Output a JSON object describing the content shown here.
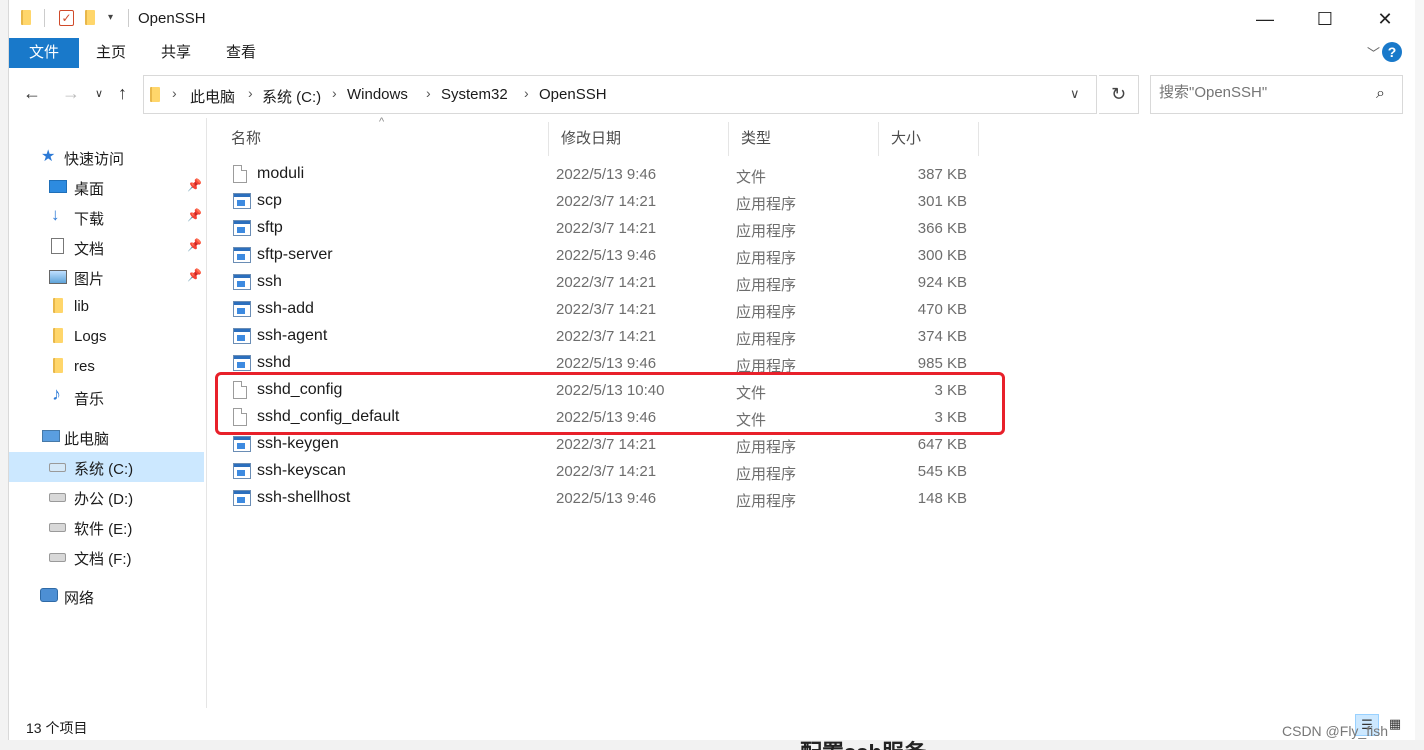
{
  "window": {
    "title": "OpenSSH",
    "controls": {
      "minimize": "—",
      "maximize": "☐",
      "close": "✕"
    }
  },
  "ribbon": {
    "tabs": [
      "文件",
      "主页",
      "共享",
      "查看"
    ],
    "help": "?"
  },
  "address": {
    "crumbs": [
      "此电脑",
      "系统 (C:)",
      "Windows",
      "System32",
      "OpenSSH"
    ]
  },
  "search": {
    "placeholder": "搜索\"OpenSSH\""
  },
  "navpane": {
    "quick_access": "快速访问",
    "items": [
      {
        "label": "桌面",
        "pinned": true
      },
      {
        "label": "下载",
        "pinned": true
      },
      {
        "label": "文档",
        "pinned": true
      },
      {
        "label": "图片",
        "pinned": true
      },
      {
        "label": "lib"
      },
      {
        "label": "Logs"
      },
      {
        "label": "res"
      },
      {
        "label": "音乐"
      }
    ],
    "this_pc": "此电脑",
    "drives": [
      "系统 (C:)",
      "办公 (D:)",
      "软件 (E:)",
      "文档 (F:)"
    ],
    "network": "网络"
  },
  "columns": {
    "name": "名称",
    "date": "修改日期",
    "type": "类型",
    "size": "大小"
  },
  "files": [
    {
      "name": "moduli",
      "date": "2022/5/13 9:46",
      "type": "文件",
      "size": "387 KB",
      "icon": "document-icon"
    },
    {
      "name": "scp",
      "date": "2022/3/7 14:21",
      "type": "应用程序",
      "size": "301 KB",
      "icon": "application-icon"
    },
    {
      "name": "sftp",
      "date": "2022/3/7 14:21",
      "type": "应用程序",
      "size": "366 KB",
      "icon": "application-icon"
    },
    {
      "name": "sftp-server",
      "date": "2022/5/13 9:46",
      "type": "应用程序",
      "size": "300 KB",
      "icon": "application-icon"
    },
    {
      "name": "ssh",
      "date": "2022/3/7 14:21",
      "type": "应用程序",
      "size": "924 KB",
      "icon": "application-icon"
    },
    {
      "name": "ssh-add",
      "date": "2022/3/7 14:21",
      "type": "应用程序",
      "size": "470 KB",
      "icon": "application-icon"
    },
    {
      "name": "ssh-agent",
      "date": "2022/3/7 14:21",
      "type": "应用程序",
      "size": "374 KB",
      "icon": "application-icon"
    },
    {
      "name": "sshd",
      "date": "2022/5/13 9:46",
      "type": "应用程序",
      "size": "985 KB",
      "icon": "application-icon"
    },
    {
      "name": "sshd_config",
      "date": "2022/5/13 10:40",
      "type": "文件",
      "size": "3 KB",
      "icon": "document-icon"
    },
    {
      "name": "sshd_config_default",
      "date": "2022/5/13 9:46",
      "type": "文件",
      "size": "3 KB",
      "icon": "document-icon"
    },
    {
      "name": "ssh-keygen",
      "date": "2022/3/7 14:21",
      "type": "应用程序",
      "size": "647 KB",
      "icon": "application-icon"
    },
    {
      "name": "ssh-keyscan",
      "date": "2022/3/7 14:21",
      "type": "应用程序",
      "size": "545 KB",
      "icon": "application-icon"
    },
    {
      "name": "ssh-shellhost",
      "date": "2022/5/13 9:46",
      "type": "应用程序",
      "size": "148 KB",
      "icon": "application-icon"
    }
  ],
  "status": {
    "count": "13 个项目"
  },
  "background": {
    "watermark": "CSDN @Fly_fish",
    "bottom_text": "配置ssh服务"
  },
  "colors": {
    "accent": "#1979ca",
    "selection": "#cce8ff",
    "highlight_box": "#e8202a"
  }
}
